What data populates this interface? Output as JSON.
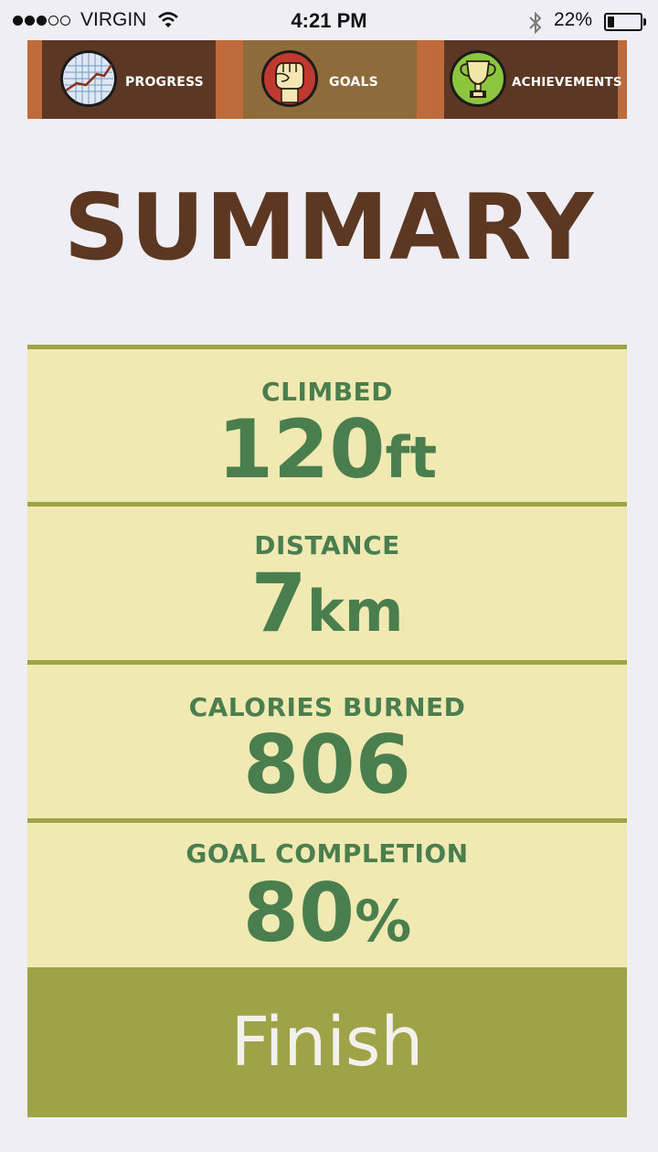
{
  "status_bar": {
    "carrier": "VIRGIN",
    "time": "4:21 PM",
    "battery_percent": "22%",
    "battery_level": 0.22,
    "signal_bars_filled": 3,
    "signal_bars_total": 5
  },
  "tabs": [
    {
      "label": "PROGRESS",
      "icon": "chart-icon",
      "active": false
    },
    {
      "label": "GOALS",
      "icon": "fist-icon",
      "active": true
    },
    {
      "label": "ACHIEVEMENTS",
      "icon": "trophy-icon",
      "active": false
    }
  ],
  "title": "SUMMARY",
  "stats": [
    {
      "label": "CLIMBED",
      "value": "120",
      "unit": "ft"
    },
    {
      "label": "DISTANCE",
      "value": "7",
      "unit": "km"
    },
    {
      "label": "CALORIES BURNED",
      "value": "806",
      "unit": ""
    },
    {
      "label": "GOAL COMPLETION",
      "value": "80",
      "unit": "%"
    }
  ],
  "finish_label": "Finish",
  "colors": {
    "background": "#efeef4",
    "tab_bar_accent": "#bf6a3a",
    "tab_dark": "#5c3824",
    "tab_active": "#8e6b3a",
    "title": "#5c3823",
    "stat_bg": "#f0eab2",
    "stat_divider": "#9ea347",
    "stat_text": "#4a7e4e",
    "finish_bg": "#9ea347"
  }
}
